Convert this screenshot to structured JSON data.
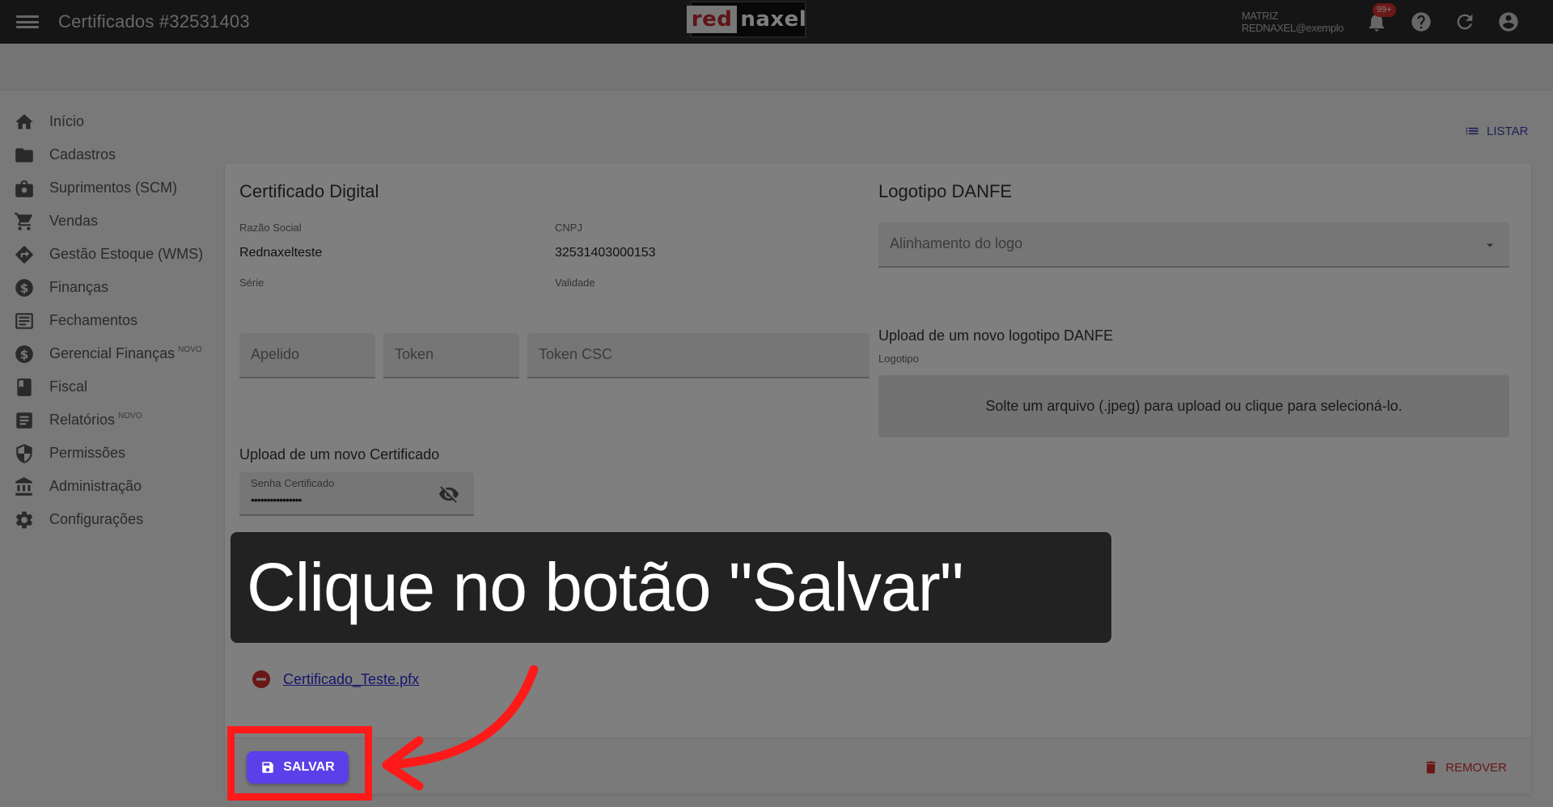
{
  "header": {
    "title": "Certificados #32531403",
    "logo_left": "red",
    "logo_right": "naxel",
    "user_company": "MATRIZ",
    "user_email": "REDNAXEL@exemplo",
    "notif_count": "99+"
  },
  "sidebar": {
    "items": [
      {
        "label": "Início",
        "icon": "home-icon"
      },
      {
        "label": "Cadastros",
        "icon": "folder-icon"
      },
      {
        "label": "Suprimentos (SCM)",
        "icon": "briefcase-icon"
      },
      {
        "label": "Vendas",
        "icon": "cart-icon"
      },
      {
        "label": "Gestão Estoque (WMS)",
        "icon": "diamond-arrow-icon"
      },
      {
        "label": "Finanças",
        "icon": "dollar-icon"
      },
      {
        "label": "Fechamentos",
        "icon": "list-box-icon"
      },
      {
        "label": "Gerencial Finanças",
        "icon": "dollar-icon",
        "badge": "NOVO"
      },
      {
        "label": "Fiscal",
        "icon": "book-icon"
      },
      {
        "label": "Relatórios",
        "icon": "report-icon",
        "badge": "NOVO"
      },
      {
        "label": "Permissões",
        "icon": "shield-icon"
      },
      {
        "label": "Administração",
        "icon": "bank-icon"
      },
      {
        "label": "Configurações",
        "icon": "gear-icon"
      }
    ]
  },
  "toolbar": {
    "listar_label": "LISTAR"
  },
  "certificate": {
    "section_title": "Certificado Digital",
    "razao_social_label": "Razão Social",
    "razao_social_value": "Rednaxelteste",
    "cnpj_label": "CNPJ",
    "cnpj_value": "32531403000153",
    "serie_label": "Série",
    "validade_label": "Validade",
    "apelido_placeholder": "Apelido",
    "token_placeholder": "Token",
    "token_csc_placeholder": "Token CSC",
    "upload_title": "Upload de um novo Certificado",
    "senha_label": "Senha Certificado",
    "senha_value": "••••••••••••••••",
    "file_name": "Certificado_Teste.pfx"
  },
  "logo_danfe": {
    "section_title": "Logotipo DANFE",
    "alignment_placeholder": "Alinhamento do logo",
    "upload_title": "Upload de um novo logotipo DANFE",
    "logotipo_label": "Logotipo",
    "dropzone_text": "Solte um arquivo (.jpeg) para upload ou clique para selecioná-lo."
  },
  "footer": {
    "save_label": "SALVAR",
    "remove_label": "REMOVER"
  },
  "tutorial": {
    "caption": "Clique no botão \"Salvar\""
  },
  "colors": {
    "accent": "#5b3fe8",
    "highlight": "#ff1a1a",
    "danger": "#d32f2f",
    "topbar": "#2b2b2b"
  }
}
